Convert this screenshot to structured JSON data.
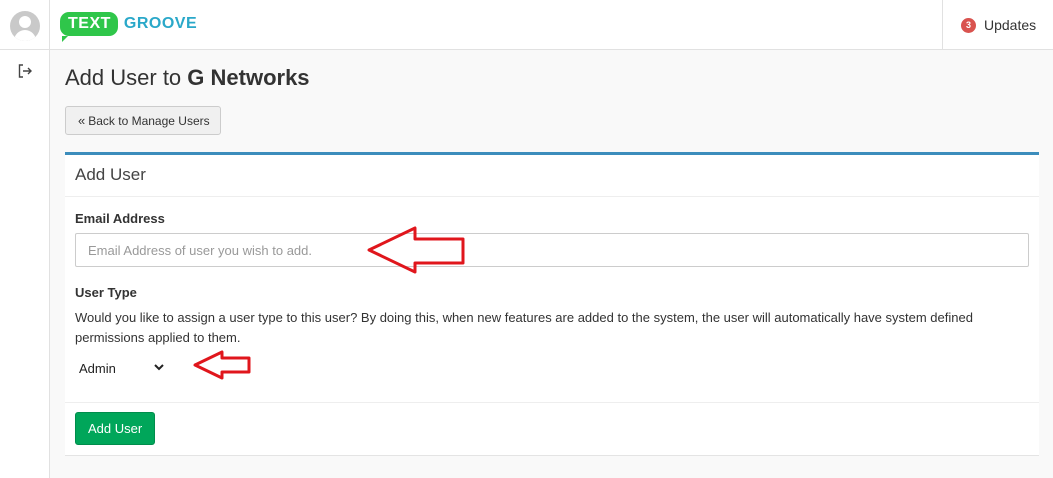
{
  "header": {
    "logo": {
      "part1": "TEXT",
      "part2": "GROOVE"
    },
    "updates": {
      "count": "3",
      "label": "Updates"
    }
  },
  "page": {
    "title_prefix": "Add User to ",
    "title_org": "G Networks",
    "back_label": "Back to Manage Users"
  },
  "panel": {
    "title": "Add User",
    "email": {
      "label": "Email Address",
      "placeholder": "Email Address of user you wish to add.",
      "value": ""
    },
    "user_type": {
      "label": "User Type",
      "help": "Would you like to assign a user type to this user? By doing this, when new features are added to the system, the user will automatically have system defined permissions applied to them.",
      "selected": "Admin"
    },
    "submit_label": "Add User"
  },
  "colors": {
    "accent": "#3c8dbc",
    "success": "#00a65a",
    "badge": "#d9534f",
    "annotation": "#e0161c",
    "logo_green": "#2fc64a",
    "logo_blue": "#2aa8c9"
  },
  "icons": [
    "avatar",
    "logout-icon",
    "chevron-double-left-icon",
    "chevron-down-icon",
    "annotation-arrow"
  ]
}
